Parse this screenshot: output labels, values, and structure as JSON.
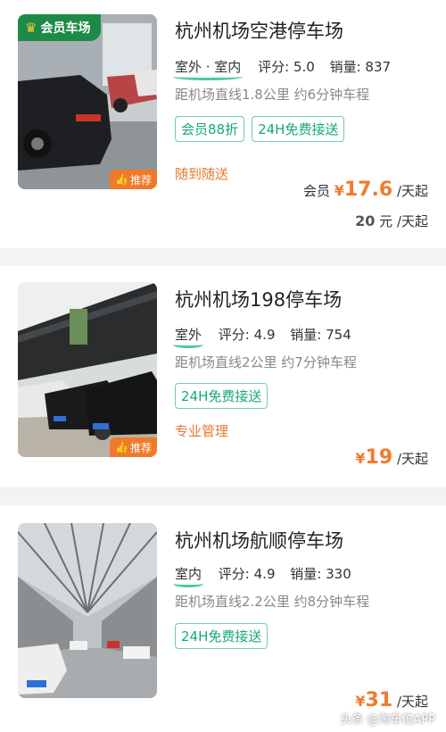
{
  "listings": [
    {
      "name": "杭州机场空港停车场",
      "type": "室外 · 室内",
      "rating_label": "评分:",
      "rating": "5.0",
      "sales_label": "销量:",
      "sales": "837",
      "distance": "距机场直线1.8公里 约6分钟车程",
      "tags": [
        "会员88折",
        "24H免费接送"
      ],
      "service": "随到随送",
      "member_badge": "会员车场",
      "recommend_badge": "推荐",
      "member_label": "会员",
      "currency": "¥",
      "member_price": "17.6",
      "price_unit": "/天起",
      "regular_price": "20",
      "regular_unit": "元 /天起"
    },
    {
      "name": "杭州机场198停车场",
      "type": "室外",
      "rating_label": "评分:",
      "rating": "4.9",
      "sales_label": "销量:",
      "sales": "754",
      "distance": "距机场直线2公里 约7分钟车程",
      "tags": [
        "24H免费接送"
      ],
      "service": "专业管理",
      "recommend_badge": "推荐",
      "currency": "¥",
      "price": "19",
      "price_unit": "/天起"
    },
    {
      "name": "杭州机场航顺停车场",
      "type": "室内",
      "rating_label": "评分:",
      "rating": "4.9",
      "sales_label": "销量:",
      "sales": "330",
      "distance": "距机场直线2.2公里 约8分钟车程",
      "tags": [
        "24H免费接送"
      ],
      "currency": "¥",
      "price": "31",
      "price_unit": "/天起"
    }
  ],
  "watermark": "头条 @淘车位APP",
  "colors": {
    "accent_green": "#17a878",
    "price_orange": "#f07a2c",
    "member_badge_green": "#1e8a47"
  }
}
